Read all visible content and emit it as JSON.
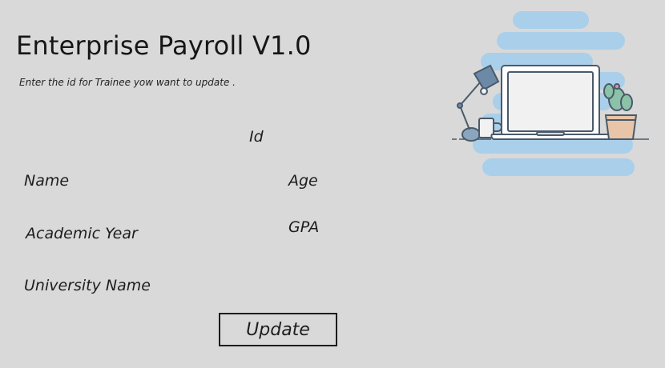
{
  "header": {
    "title": "Enterprise Payroll V1.0",
    "subtitle": "Enter the id for Trainee yow want to update ."
  },
  "form": {
    "id_label": "Id",
    "name_label": "Name",
    "age_label": "Age",
    "academic_year_label": "Academic Year",
    "gpa_label": "GPA",
    "university_name_label": "University Name"
  },
  "actions": {
    "update_label": "Update"
  },
  "illustration": {
    "icon": "laptop-desk-illustration",
    "colors": {
      "cloud": "#a9cfea",
      "outline": "#4a5a6a",
      "screen": "#f1f1f1",
      "lamp": "#6c8aa8",
      "cactus": "#8cc2a8",
      "pot": "#e8c4a8"
    }
  }
}
